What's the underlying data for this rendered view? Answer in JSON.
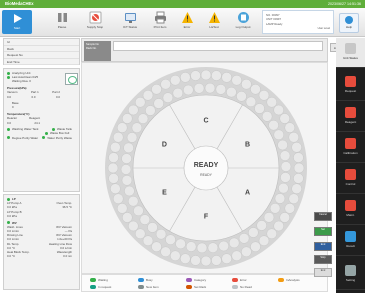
{
  "app": {
    "logo": "BioMedaCHEx",
    "datetime": "2023/06/27 14:51:36"
  },
  "toolbar": {
    "buttons": [
      {
        "id": "start",
        "label": "Start",
        "icon": "play-icon"
      },
      {
        "id": "pause",
        "label": "Pause",
        "icon": "pause-icon"
      },
      {
        "id": "supply_stop",
        "label": "Supply Stop",
        "icon": "supply-stop-icon"
      },
      {
        "id": "ict_status",
        "label": "ICT Status",
        "icon": "monitor-icon"
      },
      {
        "id": "print_item",
        "label": "Print Item",
        "icon": "printer-icon"
      },
      {
        "id": "error",
        "label": "Error",
        "icon": "warning-icon"
      },
      {
        "id": "lstest",
        "label": "LisTest",
        "icon": "warning-icon"
      },
      {
        "id": "log_output",
        "label": "Log Output",
        "icon": "log-output-icon"
      }
    ],
    "status": {
      "no_label": "NO.",
      "no_value": "00397",
      "unit_label": "UNIT",
      "unit_value": "00397",
      "lamp_label": "LAMP",
      "lamp_value": "Ready",
      "user_level": "User Level"
    },
    "help_label": "Help"
  },
  "sample_info": {
    "rows": [
      "Id",
      "Rack",
      "Request No",
      "End Time"
    ]
  },
  "status_panel": {
    "analyzing_label": "Analyzing Unit",
    "last_autoclean_label": "Last AutoClean",
    "last_autoclean_value": "04/5",
    "waiting_label": "Waiting Rea.",
    "waiting_value": "0",
    "pressure_title": "Pressure(kPa)",
    "pressure_cols": [
      "Vacuum",
      "Part 1",
      "Part 2"
    ],
    "pressure_vals": [
      "0.0",
      "0.0",
      "0.0"
    ],
    "base_label": "Base",
    "base_value": "0",
    "temp_title": "Temperature(°C)",
    "temp_cols": [
      "Reactor",
      "Reagent"
    ],
    "temp_vals": [
      "0.0",
      "24.1"
    ],
    "bottle1": "Washing Water Tank",
    "bottle2": "Waste Tank",
    "bottle3": "Waste Box Full",
    "bottle4": "Degree Purity Water",
    "bottle5": "Water Purity Waste"
  },
  "settings_panel": {
    "lp_title": "LP",
    "lp_pump_a_label": "LP Pump A",
    "lp_pump_a_value": "0.0 kPa",
    "lp_pump_b_label": "LP Pump B",
    "lp_pump_b_value": "0.0 kPa",
    "oven_label": "Oven Temp.",
    "oven_value": "36.5 °C",
    "wv_title": "WV",
    "wv_items": [
      {
        "label": "Wash. Lines",
        "value": "0.0 L/min"
      },
      {
        "label": "Rinsing Line",
        "value": "0.0 L/min"
      },
      {
        "label": "DL Temp.",
        "value": "0.0 °C"
      },
      {
        "label": "Heat Block Temp.",
        "value": "0.0 °C"
      }
    ],
    "wv_right": [
      {
        "label": "WV Vacuum",
        "value": "— Pa"
      },
      {
        "label": "WV Vacuum",
        "value": "1.0e+00 Pa"
      },
      {
        "label": "Heating Line Flow",
        "value": "0.0 L/min"
      },
      {
        "label": "Wavelength",
        "value": "0.0 nm"
      }
    ]
  },
  "rack_area": {
    "rack_no_label": "Sample No",
    "rack_label": "Rack No.",
    "list_button": "List"
  },
  "carousel": {
    "center_title": "READY",
    "center_sub": "READY",
    "sections": [
      "A",
      "B",
      "C",
      "D",
      "E",
      "F"
    ],
    "colors": {
      "bg": "#d5d5d5",
      "pos": "#e8e8e8",
      "sector": "#f2f2f2"
    }
  },
  "legend": {
    "items": [
      {
        "label": "Waiting",
        "color": "#35b04a"
      },
      {
        "label": "Busy",
        "color": "#2f8fd6"
      },
      {
        "label": "Category",
        "color": "#9b59b6"
      },
      {
        "label": "Error",
        "color": "#e74c3c"
      },
      {
        "label": "InAnalysis",
        "color": "#f39c12"
      },
      {
        "label": "In request",
        "color": "#16a085"
      },
      {
        "label": "New Item",
        "color": "#7f8c8d"
      },
      {
        "label": "Set Rack",
        "color": "#d35400"
      },
      {
        "label": "No Read",
        "color": "#bdc3c7"
      }
    ]
  },
  "right_buttons": [
    "Cancel",
    "Set",
    "End",
    "Stop",
    "End"
  ],
  "rightnav": {
    "items": [
      {
        "label": "Unit Status",
        "color": "#ffffff",
        "active": true
      },
      {
        "label": "Request",
        "color": "#e74c3c"
      },
      {
        "label": "Reagent",
        "color": "#e74c3c"
      },
      {
        "label": "Calibration",
        "color": "#e74c3c"
      },
      {
        "label": "Control",
        "color": "#e74c3c"
      },
      {
        "label": "Maint.",
        "color": "#e74c3c"
      },
      {
        "label": "Result",
        "color": "#3498db"
      },
      {
        "label": "Setting",
        "color": "#95a5a6"
      }
    ]
  }
}
